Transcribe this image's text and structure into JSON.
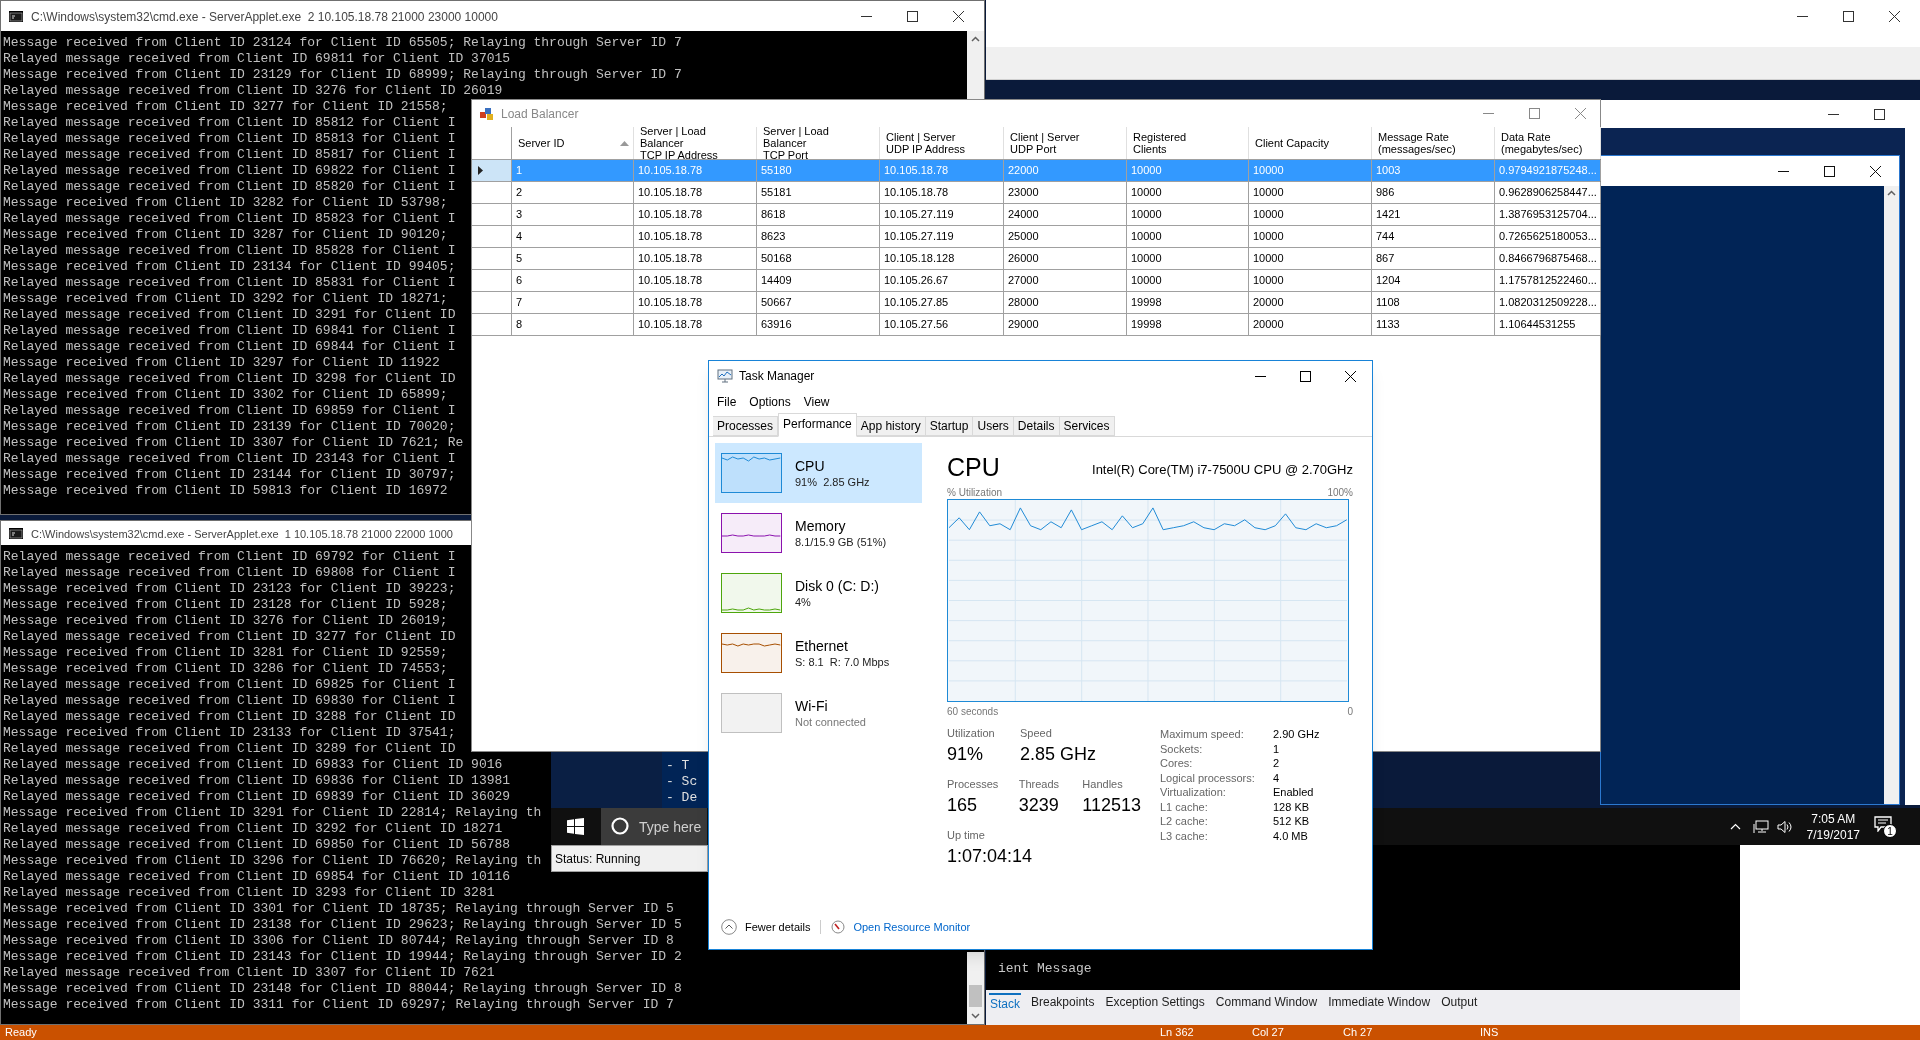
{
  "console_windows": [
    {
      "title": "C:\\Windows\\system32\\cmd.exe - ServerApplet.exe  2 10.105.18.78 21000 23000 10000",
      "lines": [
        "Message received from Client ID 23124 for Client ID 65505; Relaying through Server ID 7",
        "Relayed message received from Client ID 69811 for Client ID 37015",
        "Message received from Client ID 23129 for Client ID 68999; Relaying through Server ID 7",
        "Relayed message received from Client ID 3276 for Client ID 26019",
        "Message received from Client ID 3277 for Client ID 21558;",
        "Relayed message received from Client ID 85812 for Client I",
        "Relayed message received from Client ID 85813 for Client I",
        "Relayed message received from Client ID 85817 for Client I",
        "Relayed message received from Client ID 69822 for Client I",
        "Relayed message received from Client ID 85820 for Client I",
        "Message received from Client ID 3282 for Client ID 53798;",
        "Relayed message received from Client ID 85823 for Client I",
        "Message received from Client ID 3287 for Client ID 90120;",
        "Relayed message received from Client ID 85828 for Client I",
        "Message received from Client ID 23134 for Client ID 99405;",
        "Relayed message received from Client ID 85831 for Client I",
        "Message received from Client ID 3292 for Client ID 18271;",
        "Relayed message received from Client ID 3291 for Client ID",
        "Relayed message received from Client ID 69841 for Client I",
        "Relayed message received from Client ID 69844 for Client I",
        "Message received from Client ID 3297 for Client ID 11922",
        "Relayed message received from Client ID 3298 for Client ID",
        "Message received from Client ID 3302 for Client ID 65899;",
        "Relayed message received from Client ID 69859 for Client I",
        "Message received from Client ID 23139 for Client ID 70020;",
        "Message received from Client ID 3307 for Client ID 7621; Re",
        "Relayed message received from Client ID 23143 for Client I",
        "Message received from Client ID 23144 for Client ID 30797;",
        "Message received from Client ID 59813 for Client ID 16972"
      ]
    },
    {
      "title": "C:\\Windows\\system32\\cmd.exe - ServerApplet.exe  1 10.105.18.78 21000 22000 1000",
      "lines": [
        "Relayed message received from Client ID 69792 for Client I",
        "Relayed message received from Client ID 69808 for Client I",
        "Message received from Client ID 23123 for Client ID 39223;",
        "Message received from Client ID 23128 for Client ID 5928;",
        "Message received from Client ID 3276 for Client ID 26019;",
        "Relayed message received from Client ID 3277 for Client ID",
        "Message received from Client ID 3281 for Client ID 92559;",
        "Message received from Client ID 3286 for Client ID 74553;",
        "Relayed message received from Client ID 69825 for Client I",
        "Relayed message received from Client ID 69830 for Client I",
        "Relayed message received from Client ID 3288 for Client ID",
        "Message received from Client ID 23133 for Client ID 37541;",
        "Relayed message received from Client ID 3289 for Client ID",
        "Relayed message received from Client ID 69833 for Client ID 9016",
        "Relayed message received from Client ID 69836 for Client ID 13981",
        "Relayed message received from Client ID 69839 for Client ID 36029",
        "Message received from Client ID 3291 for Client ID 22814; Relaying th",
        "Relayed message received from Client ID 3292 for Client ID 18271",
        "Relayed message received from Client ID 69850 for Client ID 56788",
        "Message received from Client ID 3296 for Client ID 76620; Relaying th",
        "Relayed message received from Client ID 69854 for Client ID 10116",
        "Relayed message received from Client ID 3293 for Client ID 3281",
        "Message received from Client ID 3301 for Client ID 18735; Relaying through Server ID 5",
        "Message received from Client ID 23138 for Client ID 29623; Relaying through Server ID 5",
        "Message received from Client ID 3306 for Client ID 80744; Relaying through Server ID 8",
        "Message received from Client ID 23143 for Client ID 19944; Relaying through Server ID 2",
        "Relayed message received from Client ID 3307 for Client ID 7621",
        "Message received from Client ID 23148 for Client ID 88044; Relaying through Server ID 8",
        "Message received from Client ID 3311 for Client ID 69297; Relaying through Server ID 7"
      ]
    }
  ],
  "powershell_fragment": {
    "lines": [
      "- T",
      "- Sc",
      "- De"
    ]
  },
  "load_balancer": {
    "title": "Load Balancer",
    "columns": [
      {
        "label": "Server ID",
        "sorted": true
      },
      {
        "label": "Server | Load Balancer\nTCP IP Address"
      },
      {
        "label": "Server | Load Balancer\nTCP Port"
      },
      {
        "label": "Client | Server\nUDP IP Address"
      },
      {
        "label": "Client | Server\nUDP Port"
      },
      {
        "label": "Registered\nClients"
      },
      {
        "label": "Client Capacity"
      },
      {
        "label": "Message Rate\n(messages/sec)"
      },
      {
        "label": "Data Rate\n(megabytes/sec)"
      }
    ],
    "rows": [
      {
        "selected": true,
        "cells": [
          "1",
          "10.105.18.78",
          "55180",
          "10.105.18.78",
          "22000",
          "10000",
          "10000",
          "1003",
          "0.9794921875248..."
        ]
      },
      {
        "selected": false,
        "cells": [
          "2",
          "10.105.18.78",
          "55181",
          "10.105.18.78",
          "23000",
          "10000",
          "10000",
          "986",
          "0.9628906258447..."
        ]
      },
      {
        "selected": false,
        "cells": [
          "3",
          "10.105.18.78",
          "8618",
          "10.105.27.119",
          "24000",
          "10000",
          "10000",
          "1421",
          "1.3876953125704..."
        ]
      },
      {
        "selected": false,
        "cells": [
          "4",
          "10.105.18.78",
          "8623",
          "10.105.27.119",
          "25000",
          "10000",
          "10000",
          "744",
          "0.7265625180053..."
        ]
      },
      {
        "selected": false,
        "cells": [
          "5",
          "10.105.18.78",
          "50168",
          "10.105.18.128",
          "26000",
          "10000",
          "10000",
          "867",
          "0.8466796875468..."
        ]
      },
      {
        "selected": false,
        "cells": [
          "6",
          "10.105.18.78",
          "14409",
          "10.105.26.67",
          "27000",
          "10000",
          "10000",
          "1204",
          "1.1757812522460..."
        ]
      },
      {
        "selected": false,
        "cells": [
          "7",
          "10.105.18.78",
          "50667",
          "10.105.27.85",
          "28000",
          "19998",
          "20000",
          "1108",
          "1.0820312509228..."
        ]
      },
      {
        "selected": false,
        "cells": [
          "8",
          "10.105.18.78",
          "63916",
          "10.105.27.56",
          "29000",
          "19998",
          "20000",
          "1133",
          "1.10644531255"
        ]
      }
    ]
  },
  "task_manager": {
    "title": "Task Manager",
    "menu": [
      "File",
      "Options",
      "View"
    ],
    "tabs": [
      {
        "label": "Processes",
        "selected": false
      },
      {
        "label": "Performance",
        "selected": true
      },
      {
        "label": "App history",
        "selected": false
      },
      {
        "label": "Startup",
        "selected": false
      },
      {
        "label": "Users",
        "selected": false
      },
      {
        "label": "Details",
        "selected": false
      },
      {
        "label": "Services",
        "selected": false
      }
    ],
    "resources": [
      {
        "name": "CPU",
        "detail": "91%  2.85 GHz",
        "kind": "graph",
        "color": "#1e8ad6",
        "selected": true
      },
      {
        "name": "Memory",
        "detail": "8.1/15.9 GB (51%)",
        "kind": "graph",
        "color": "#8b12ae",
        "selected": false
      },
      {
        "name": "Disk 0 (C: D:)",
        "detail": "4%",
        "kind": "graph",
        "color": "#4da60c",
        "selected": false
      },
      {
        "name": "Ethernet",
        "detail": "S: 8.1  R: 7.0 Mbps",
        "kind": "graph",
        "color": "#a74f01",
        "selected": false
      },
      {
        "name": "Wi-Fi",
        "detail": "Not connected",
        "kind": "blank",
        "color": "#c0c0c0",
        "selected": false
      }
    ],
    "panel": {
      "heading": "CPU",
      "model": "Intel(R) Core(TM) i7-7500U CPU @ 2.70GHz",
      "graph_label": "% Utilization",
      "graph_max": "100%",
      "graph_span": "60 seconds",
      "graph_min": "0",
      "stats": [
        {
          "label": "Utilization",
          "value": "91%"
        },
        {
          "label": "Speed",
          "value": "2.85 GHz"
        }
      ],
      "counts": [
        {
          "label": "Processes",
          "value": "165"
        },
        {
          "label": "Threads",
          "value": "3239"
        },
        {
          "label": "Handles",
          "value": "112513"
        }
      ],
      "uptime": {
        "label": "Up time",
        "value": "1:07:04:14"
      },
      "specs": [
        {
          "label": "Maximum speed:",
          "value": "2.90 GHz"
        },
        {
          "label": "Sockets:",
          "value": "1"
        },
        {
          "label": "Cores:",
          "value": "2"
        },
        {
          "label": "Logical processors:",
          "value": "4"
        },
        {
          "label": "Virtualization:",
          "value": "Enabled"
        },
        {
          "label": "L1 cache:",
          "value": "128 KB"
        },
        {
          "label": "L2 cache:",
          "value": "512 KB"
        },
        {
          "label": "L3 cache:",
          "value": "4.0 MB"
        }
      ]
    },
    "footer": {
      "fewer_details": "Fewer details",
      "resource_monitor": "Open Resource Monitor"
    }
  },
  "status_window": {
    "text": "Status: Running"
  },
  "taskbar": {
    "search_placeholder": "Type here",
    "time": "7:05 AM",
    "date": "7/19/2017",
    "notification_count": "1"
  },
  "visual_studio": {
    "output_text": "ient Message",
    "tool_tabs": [
      {
        "label": "Stack",
        "selected": true
      },
      {
        "label": "Breakpoints",
        "selected": false
      },
      {
        "label": "Exception Settings",
        "selected": false
      },
      {
        "label": "Command Window",
        "selected": false
      },
      {
        "label": "Immediate Window",
        "selected": false
      },
      {
        "label": "Output",
        "selected": false
      }
    ],
    "status_bar": {
      "state": "Ready",
      "line": "Ln 362",
      "column": "Col 27",
      "char": "Ch 27",
      "mode": "INS"
    }
  }
}
